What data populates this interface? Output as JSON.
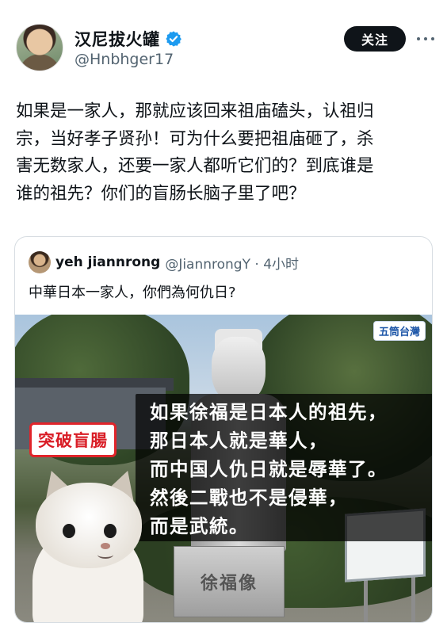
{
  "author": {
    "display_name": "汉尼拔火罐",
    "handle": "@Hnbhger17",
    "verified": true,
    "verified_color": "#1d9bf0"
  },
  "actions": {
    "follow_label": "关注",
    "more_icon": "more-horizontal-icon"
  },
  "tweet": {
    "lines": [
      "如果是一家人，那就应该回来祖庙磕头，认祖归",
      "宗，当好孝子贤孙！可为什么要把祖庙砸了，杀",
      "害无数家人，还要一家人都听它们的？到底谁是",
      "谁的祖先？你们的盲肠长脑子里了吧？"
    ]
  },
  "quote": {
    "name": "yeh jiannrong",
    "handle_time": "@JiannrongY · 4小时",
    "text": "中華日本一家人，你們為何仇日?",
    "image": {
      "source_badge": "五筒台灣",
      "label": "突破盲腸",
      "caption_lines": [
        "如果徐福是日本人的祖先，",
        "那日本人就是華人，",
        "而中国人仇日就是辱華了。",
        "然後二戰也不是侵華，",
        "而是武統。"
      ],
      "pedestal_text": "徐福像",
      "label_color": "#d91d26"
    }
  }
}
